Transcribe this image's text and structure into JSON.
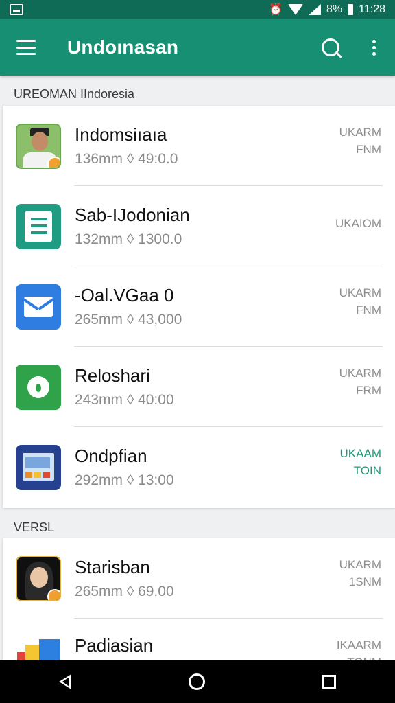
{
  "status_bar": {
    "time": "11:28",
    "battery_text": "8%"
  },
  "app_bar": {
    "title": "Undoınasan"
  },
  "sections": [
    {
      "label": "UREOMAN IIndoresia",
      "items": [
        {
          "title": "Indomsiıaıa",
          "subtitle": "136mm ◊ 49:0.0",
          "right_line1": "UKARM",
          "right_line2": "FNM",
          "icon": "person-avatar-icon"
        },
        {
          "title": "Sab-IJodonian",
          "subtitle": "132mm ◊ 1300.0",
          "right_line1": "UKAIOM",
          "right_line2": "",
          "icon": "document-list-icon"
        },
        {
          "title": "-Oal.VGaa 0",
          "subtitle": "265mm ◊ 43,000",
          "right_line1": "UKARM",
          "right_line2": "FNM",
          "icon": "mail-icon"
        },
        {
          "title": "Reloshari",
          "subtitle": "243mm ◊ 40:00",
          "right_line1": "UKARM",
          "right_line2": "FRM",
          "icon": "green-app-icon"
        },
        {
          "title": "Ondpfian",
          "subtitle": "292mm ◊ 13:00",
          "right_line1": "UKAAM",
          "right_line2": "TOIN",
          "icon": "tablet-app-icon",
          "accent": "#1a9b78"
        }
      ]
    },
    {
      "label": "VERSL",
      "items": [
        {
          "title": "Starisban",
          "subtitle": "265mm ◊ 69.00",
          "right_line1": "UKARM",
          "right_line2": "1SNM",
          "icon": "woman-avatar-icon"
        },
        {
          "title": "Padiasian",
          "subtitle": "",
          "right_line1": "IKAARM",
          "right_line2": "TONM",
          "icon": "blocks-app-icon"
        }
      ]
    }
  ],
  "colors": {
    "app_bar": "#178f73",
    "status_bar": "#0f6b56",
    "accent": "#1a9b78"
  }
}
